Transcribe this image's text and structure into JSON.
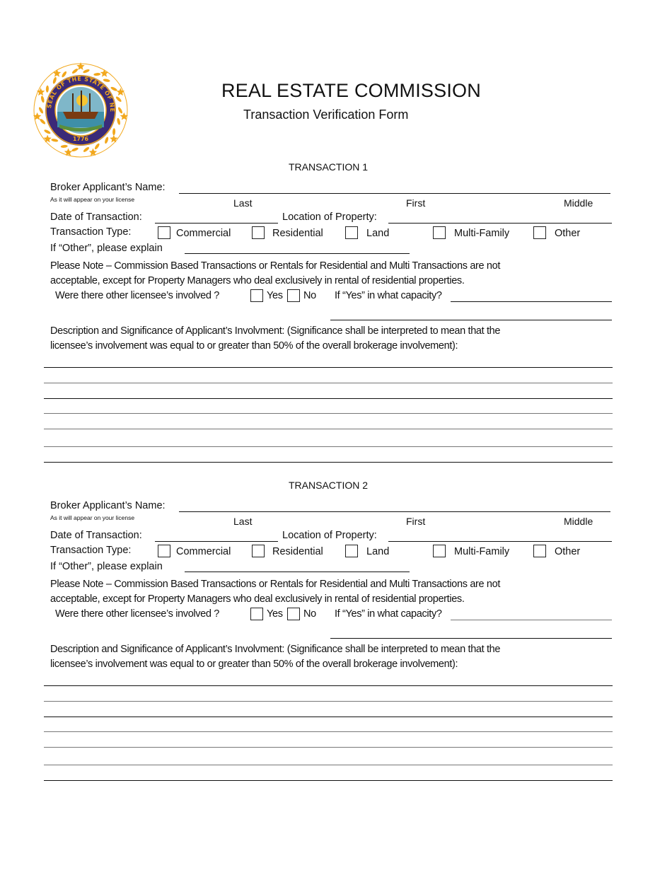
{
  "header": {
    "seal": {
      "icon": "state-seal-new-hampshire",
      "ring_text": "SEAL OF THE STATE OF NEW HAMPSHIRE",
      "year": "1776"
    },
    "title": "REAL ESTATE COMMISSION",
    "subtitle": "Transaction Verification Form"
  },
  "transactions": [
    {
      "heading": "TRANSACTION 1",
      "broker_name_label": "Broker Applicant’s Name:",
      "broker_name_hint": "As it will appear on your license",
      "name_parts": {
        "last": "Last",
        "first": "First",
        "middle": "Middle"
      },
      "date_label": "Date of Transaction:",
      "location_label": "Location of Property:",
      "type_label": "Transaction Type:",
      "types": [
        "Commercial",
        "Residential",
        "Land",
        "Multi-Family",
        "Other"
      ],
      "other_label": "If “Other”, please explain",
      "note_line1": "Please Note – Commission Based Transactions or Rentals for Residential and Multi Transactions are not",
      "note_line2": "acceptable, except for Property Managers who deal exclusively in rental of residential properties.",
      "other_licensee_label": "Were there other licensee’s involved ?",
      "yes_label": "Yes",
      "no_label": "No",
      "capacity_label": "If “Yes” in what capacity?",
      "description_line1": "Description and Significance of Applicant’s Involvment: (Significance shall be interpreted to mean that the",
      "description_line2": "licensee’s involvement was equal to or greater than 50% of the overall brokerage involvement):"
    },
    {
      "heading": "TRANSACTION 2",
      "broker_name_label": "Broker Applicant’s Name:",
      "broker_name_hint": "As it will appear on your license",
      "name_parts": {
        "last": "Last",
        "first": "First",
        "middle": "Middle"
      },
      "date_label": "Date of Transaction:",
      "location_label": "Location of Property:",
      "type_label": "Transaction Type:",
      "types": [
        "Commercial",
        "Residential",
        "Land",
        "Multi-Family",
        "Other"
      ],
      "other_label": "If “Other”, please explain",
      "note_line1": "Please Note – Commission Based Transactions or Rentals for Residential and Multi Transactions are not",
      "note_line2": "acceptable, except for Property Managers who deal exclusively in rental of residential properties.",
      "other_licensee_label": "Were there other licensee’s involved ?",
      "yes_label": "Yes",
      "no_label": "No",
      "capacity_label": "If “Yes” in what capacity?",
      "description_line1": "Description and Significance of Applicant’s Involvment: (Significance shall be interpreted to mean that the",
      "description_line2": "licensee’s involvement was equal to or greater than 50% of the overall brokerage involvement):"
    }
  ],
  "colors": {
    "seal_gold": "#F2A81D",
    "seal_navy": "#3B2A78",
    "ink": "#111111"
  }
}
